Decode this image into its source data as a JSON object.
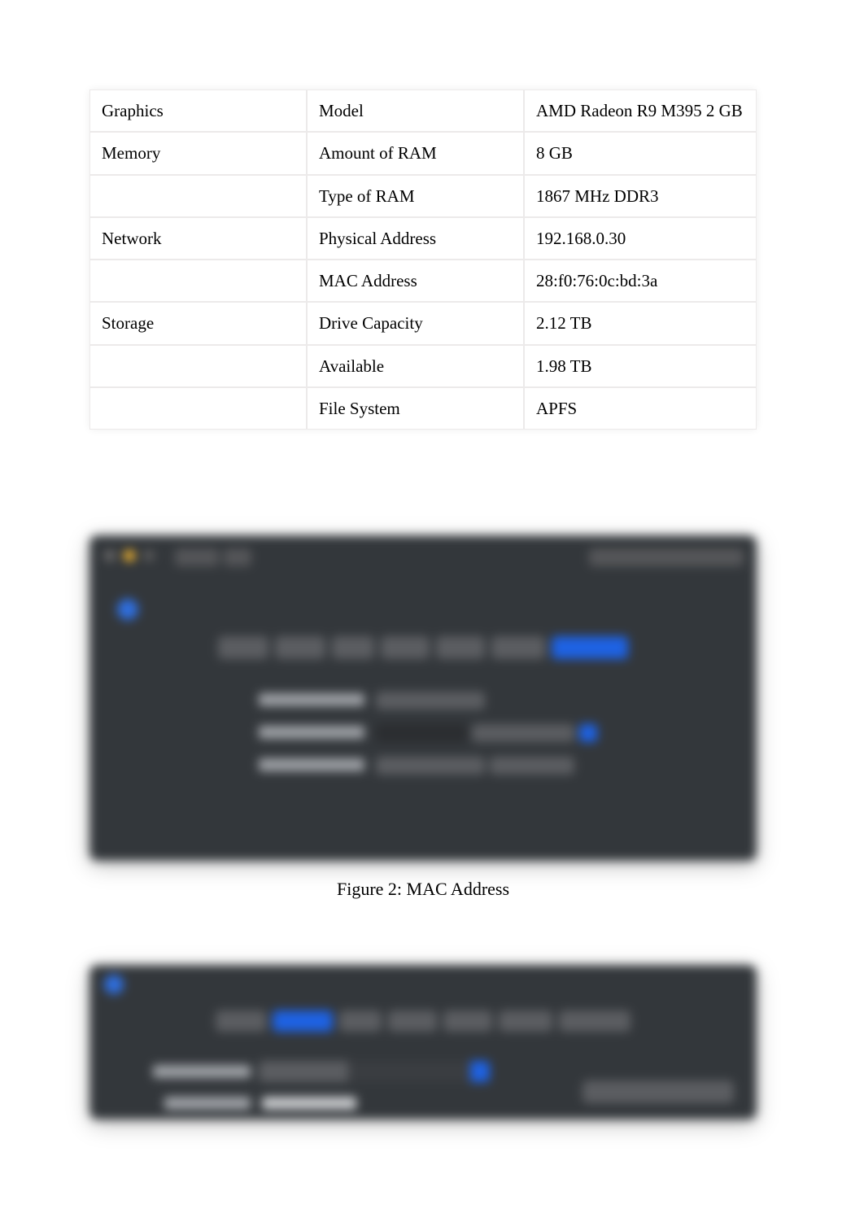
{
  "table": {
    "rows": [
      {
        "category": "Graphics",
        "label": "Model",
        "value": "AMD Radeon R9 M395 2 GB"
      },
      {
        "category": "Memory",
        "label": "Amount of RAM",
        "value": "8 GB"
      },
      {
        "category": "",
        "label": "Type of RAM",
        "value": "1867 MHz DDR3"
      },
      {
        "category": "Network",
        "label": "Physical Address",
        "value": "192.168.0.30"
      },
      {
        "category": "",
        "label": "MAC Address",
        "value": "28:f0:76:0c:bd:3a"
      },
      {
        "category": "Storage",
        "label": "Drive Capacity",
        "value": "2.12 TB"
      },
      {
        "category": "",
        "label": "Available",
        "value": "1.98 TB"
      },
      {
        "category": "",
        "label": "File System",
        "value": "APFS"
      }
    ]
  },
  "figure1": {
    "caption": "Figure 2: MAC Address"
  }
}
